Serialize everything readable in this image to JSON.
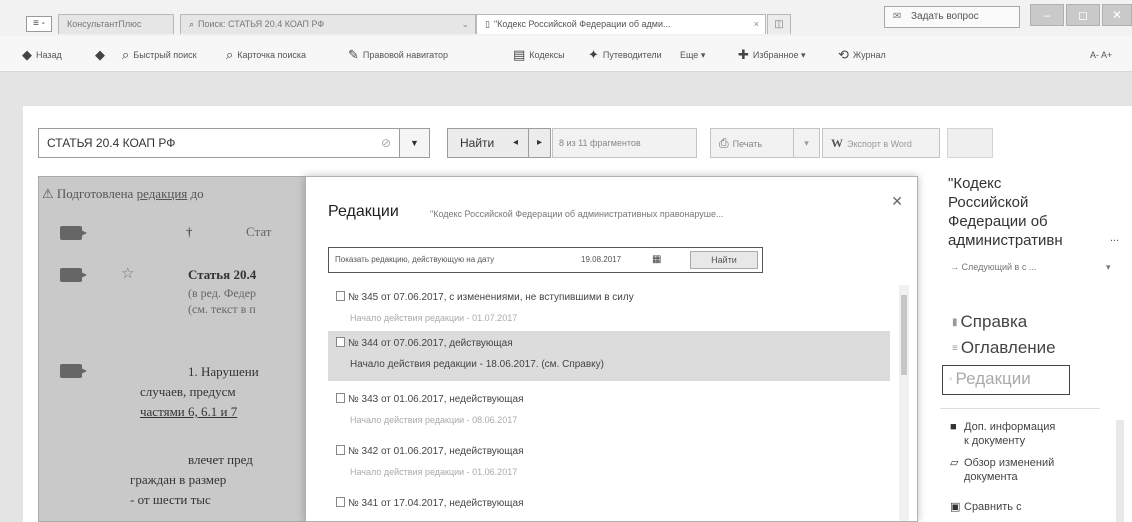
{
  "titlebar": {
    "menu_glyph": "≡ -",
    "tabs": [
      {
        "label": "КонсультантПлюс"
      },
      {
        "label": "Поиск: СТАТЬЯ 20.4 КОАП РФ"
      },
      {
        "label": "\"Кодекс Российской Федерации об адми..."
      }
    ],
    "ask_label": "Задать вопрос",
    "win_min": "–",
    "win_max": "◻",
    "win_close": "✕"
  },
  "toolbar": {
    "items": [
      "Назад",
      "Быстрый поиск",
      "Карточка поиска",
      "Правовой навигатор",
      "Кодексы",
      "Путеводители",
      "Еще",
      "Избранное",
      "Журнал"
    ],
    "font_size_label": "A- A+"
  },
  "search": {
    "query": "СТАТЬЯ 20.4 КОАП РФ",
    "find_label": "Найти",
    "found_count": "8 из 11 фрагментов",
    "print_label": "Печать",
    "word_label": "Экспорт в Word"
  },
  "document": {
    "note_prefix": "⚠ Подготовлена",
    "note_link": "редакция",
    "note_suffix": "до",
    "heading_fragment": "Стат",
    "article_title": "Статья 20.4",
    "line_1": "(в ред. Федер",
    "line_2": "(см. текст в п",
    "para_1": "1. Нарушени",
    "para_2": "случаев, предусм",
    "para_3": "частями 6, 6.1 и 7",
    "para_4": "влечет пред",
    "para_5": "граждан в размер",
    "para_6": "- от шести тыс"
  },
  "modal": {
    "title": "Редакции",
    "subtitle": "\"Кодекс Российской Федерации об административных правонаруше...",
    "date_label": "Показать редакцию, действующую на дату",
    "date_value": "19.08.2017",
    "date_find_label": "Найти",
    "items": [
      {
        "title": "№ 345 от 07.06.2017, с изменениями, не вступившими в силу",
        "start": "Начало действия редакции - 01.07.2017"
      },
      {
        "title": "№ 344 от 07.06.2017, действующая",
        "start": "Начало действия редакции - 18.06.2017. (см. Справку)"
      },
      {
        "title": "№ 343 от 01.06.2017, недействующая",
        "start": "Начало действия редакции - 08.06.2017"
      },
      {
        "title": "№ 342 от 01.06.2017, недействующая",
        "start": "Начало действия редакции - 01.06.2017"
      },
      {
        "title": "№ 341 от 17.04.2017, недействующая",
        "start": ""
      }
    ]
  },
  "right_panel": {
    "title_lines": [
      "\"Кодекс",
      "Российской",
      "Федерации об",
      "административн"
    ],
    "ellipsis": "...",
    "next_label": "Следующий в с",
    "links": [
      "Справка",
      "Оглавление"
    ],
    "redaction_label": "Редакции",
    "extra_info": [
      "Доп. информация",
      "к документу"
    ],
    "review_changes": [
      "Обзор изменений",
      "документа"
    ],
    "compare": [
      "Сравнить с"
    ]
  }
}
